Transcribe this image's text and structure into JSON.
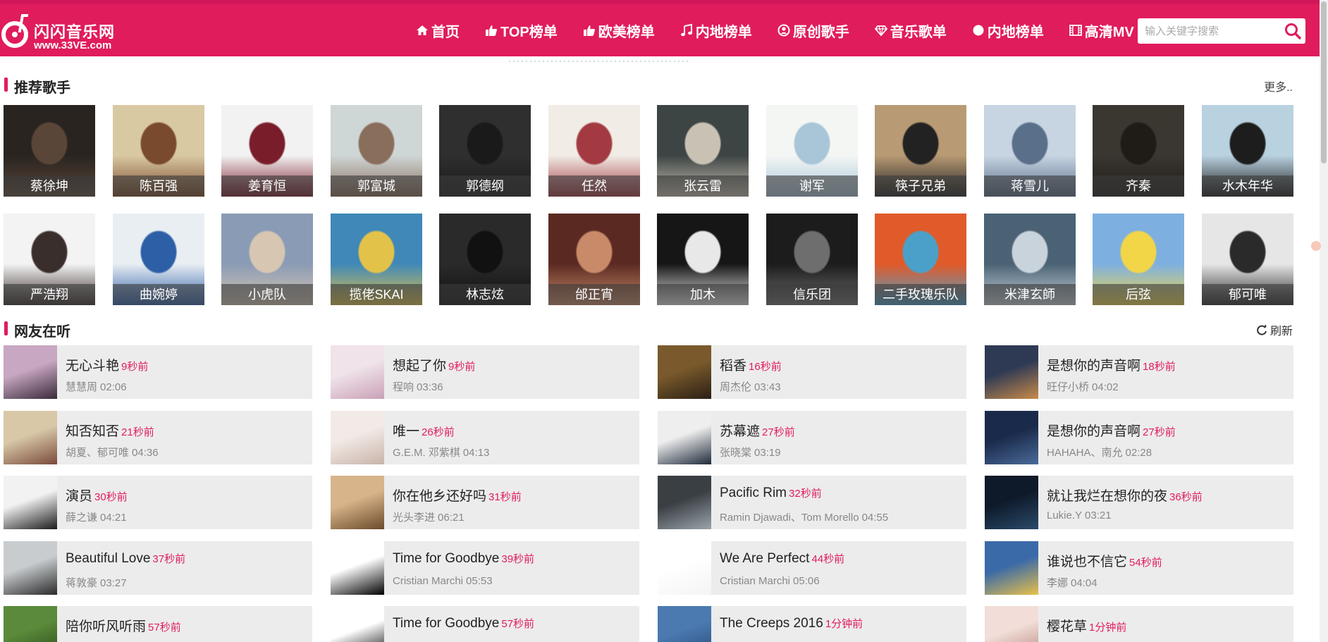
{
  "header": {
    "logo_name": "闪闪音乐网",
    "logo_url": "www.33VE.com",
    "nav": [
      {
        "label": "首页",
        "icon": "home-icon"
      },
      {
        "label": "TOP榜单",
        "icon": "thumbs-up-icon"
      },
      {
        "label": "欧美榜单",
        "icon": "thumbs-up-icon"
      },
      {
        "label": "内地榜单",
        "icon": "music-note-icon"
      },
      {
        "label": "原创歌手",
        "icon": "user-circle-icon"
      },
      {
        "label": "音乐歌单",
        "icon": "diamond-icon"
      },
      {
        "label": "内地榜单",
        "icon": "dot-icon"
      },
      {
        "label": "高清MV",
        "icon": "film-icon"
      }
    ],
    "search_placeholder": "输入关键字搜索",
    "search_icon": "search-icon",
    "accent_color": "#e01c5c"
  },
  "singers_section": {
    "title": "推荐歌手",
    "more_label": "更多..",
    "singers": [
      {
        "name": "蔡徐坤",
        "colors": [
          "#2a2420",
          "#5a4638"
        ]
      },
      {
        "name": "陈百强",
        "colors": [
          "#d9c9a3",
          "#7a4a2c"
        ]
      },
      {
        "name": "姜育恒",
        "colors": [
          "#f2f2f2",
          "#7a1d2a"
        ]
      },
      {
        "name": "郭富城",
        "colors": [
          "#cfd6d6",
          "#8a6e5c"
        ]
      },
      {
        "name": "郭德纲",
        "colors": [
          "#2f2f2f",
          "#1a1a1a"
        ]
      },
      {
        "name": "任然",
        "colors": [
          "#f1ece6",
          "#a33a42"
        ]
      },
      {
        "name": "张云雷",
        "colors": [
          "#3d4444",
          "#c9c2b4"
        ]
      },
      {
        "name": "谢军",
        "colors": [
          "#f4f6f4",
          "#a8c6d8"
        ]
      },
      {
        "name": "筷子兄弟",
        "colors": [
          "#b89a74",
          "#222222"
        ]
      },
      {
        "name": "蒋雪儿",
        "colors": [
          "#c7d4e2",
          "#5a6f8a"
        ]
      },
      {
        "name": "齐秦",
        "colors": [
          "#3a3630",
          "#1f1c18"
        ]
      },
      {
        "name": "水木年华",
        "colors": [
          "#b9d2e0",
          "#1d1d1d"
        ]
      },
      {
        "name": "严浩翔",
        "colors": [
          "#f3f3f3",
          "#3a2e2c"
        ]
      },
      {
        "name": "曲婉婷",
        "colors": [
          "#e9eef3",
          "#2d5fa6"
        ]
      },
      {
        "name": "小虎队",
        "colors": [
          "#8a9bb5",
          "#d6c6b2"
        ]
      },
      {
        "name": "揽佬SKAI",
        "colors": [
          "#3f88b8",
          "#e3c24a"
        ]
      },
      {
        "name": "林志炫",
        "colors": [
          "#2a2a2a",
          "#111111"
        ]
      },
      {
        "name": "邰正宵",
        "colors": [
          "#5a2a22",
          "#c98a6a"
        ]
      },
      {
        "name": "加木",
        "colors": [
          "#161616",
          "#e8e8e8"
        ]
      },
      {
        "name": "信乐团",
        "colors": [
          "#1c1c1c",
          "#6e6e6e"
        ]
      },
      {
        "name": "二手玫瑰乐队",
        "colors": [
          "#e05a2a",
          "#4aa0c8"
        ]
      },
      {
        "name": "米津玄師",
        "colors": [
          "#4a6274",
          "#c9d3dc"
        ]
      },
      {
        "name": "后弦",
        "colors": [
          "#7db0e0",
          "#f2d648"
        ]
      },
      {
        "name": "郁可唯",
        "colors": [
          "#e6e6e6",
          "#2a2a2a"
        ]
      }
    ]
  },
  "listening_section": {
    "title": "网友在听",
    "refresh_label": "刷新",
    "songs": [
      {
        "title": "无心斗艳",
        "time": "9秒前",
        "artist": "慧慧周",
        "duration": "02:06",
        "colors": [
          "#c8a7c2",
          "#3a2a3a"
        ]
      },
      {
        "title": "想起了你",
        "time": "9秒前",
        "artist": "程响",
        "duration": "03:36",
        "colors": [
          "#f0e3ea",
          "#c9a1b7"
        ]
      },
      {
        "title": "稻香",
        "time": "16秒前",
        "artist": "周杰伦",
        "duration": "03:43",
        "colors": [
          "#7a5a2c",
          "#2a1f14"
        ]
      },
      {
        "title": "是想你的声音啊",
        "time": "18秒前",
        "artist": "旺仔小桥",
        "duration": "04:02",
        "colors": [
          "#2e3a54",
          "#c98a4a"
        ]
      },
      {
        "title": "知否知否",
        "time": "21秒前",
        "artist": "胡夏、郁可唯",
        "duration": "04:36",
        "colors": [
          "#d8c8a8",
          "#7a4a3a"
        ]
      },
      {
        "title": "唯一",
        "time": "26秒前",
        "artist": "G.E.M. 邓紫棋",
        "duration": "04:13",
        "colors": [
          "#f2eae6",
          "#c8b4aa"
        ]
      },
      {
        "title": "苏幕遮",
        "time": "27秒前",
        "artist": "张晓棠",
        "duration": "03:19",
        "colors": [
          "#eeeeee",
          "#1e2a3a"
        ]
      },
      {
        "title": "是想你的声音啊",
        "time": "27秒前",
        "artist": "HAHAHA、南允",
        "duration": "02:28",
        "colors": [
          "#1a2a4a",
          "#4a6a9a"
        ]
      },
      {
        "title": "演员",
        "time": "30秒前",
        "artist": "薛之谦",
        "duration": "04:21",
        "colors": [
          "#f2f2f2",
          "#1a1a1a"
        ]
      },
      {
        "title": "你在他乡还好吗",
        "time": "31秒前",
        "artist": "光头李进",
        "duration": "06:21",
        "colors": [
          "#d8b48a",
          "#6a4a2a"
        ]
      },
      {
        "title": "Pacific Rim",
        "time": "32秒前",
        "artist": "Ramin Djawadi、Tom Morello",
        "duration": "04:55",
        "colors": [
          "#3a3f44",
          "#9aa4aa"
        ]
      },
      {
        "title": "就让我烂在想你的夜",
        "time": "36秒前",
        "artist": "Lukie.Y",
        "duration": "03:21",
        "colors": [
          "#0e1a2a",
          "#2a4a6a"
        ]
      },
      {
        "title": "Beautiful Love",
        "time": "37秒前",
        "artist": "蒋敦豪",
        "duration": "03:27",
        "colors": [
          "#c8ccce",
          "#2a2a2a"
        ]
      },
      {
        "title": "Time for Goodbye",
        "time": "39秒前",
        "artist": "Cristian Marchi",
        "duration": "05:53",
        "colors": [
          "#ffffff",
          "#000000"
        ]
      },
      {
        "title": "We Are Perfect",
        "time": "44秒前",
        "artist": "Cristian Marchi",
        "duration": "05:06",
        "colors": [
          "#ffffff",
          "#f4f4f4"
        ]
      },
      {
        "title": "谁说也不信它",
        "time": "54秒前",
        "artist": "李娜",
        "duration": "04:04",
        "colors": [
          "#3a6aa8",
          "#e8c04a"
        ]
      },
      {
        "title": "陪你听风听雨",
        "time": "57秒前",
        "artist": "",
        "duration": "",
        "colors": [
          "#5a8a3a",
          "#2a4a1a"
        ]
      },
      {
        "title": "Time for Goodbye",
        "time": "57秒前",
        "artist": "",
        "duration": "",
        "colors": [
          "#ffffff",
          "#000000"
        ]
      },
      {
        "title": "The Creeps 2016",
        "time": "1分钟前",
        "artist": "",
        "duration": "",
        "colors": [
          "#4a7ab0",
          "#2a4a7a"
        ]
      },
      {
        "title": "樱花草",
        "time": "1分钟前",
        "artist": "",
        "duration": "",
        "colors": [
          "#f2ddd8",
          "#b88a80"
        ]
      }
    ]
  }
}
